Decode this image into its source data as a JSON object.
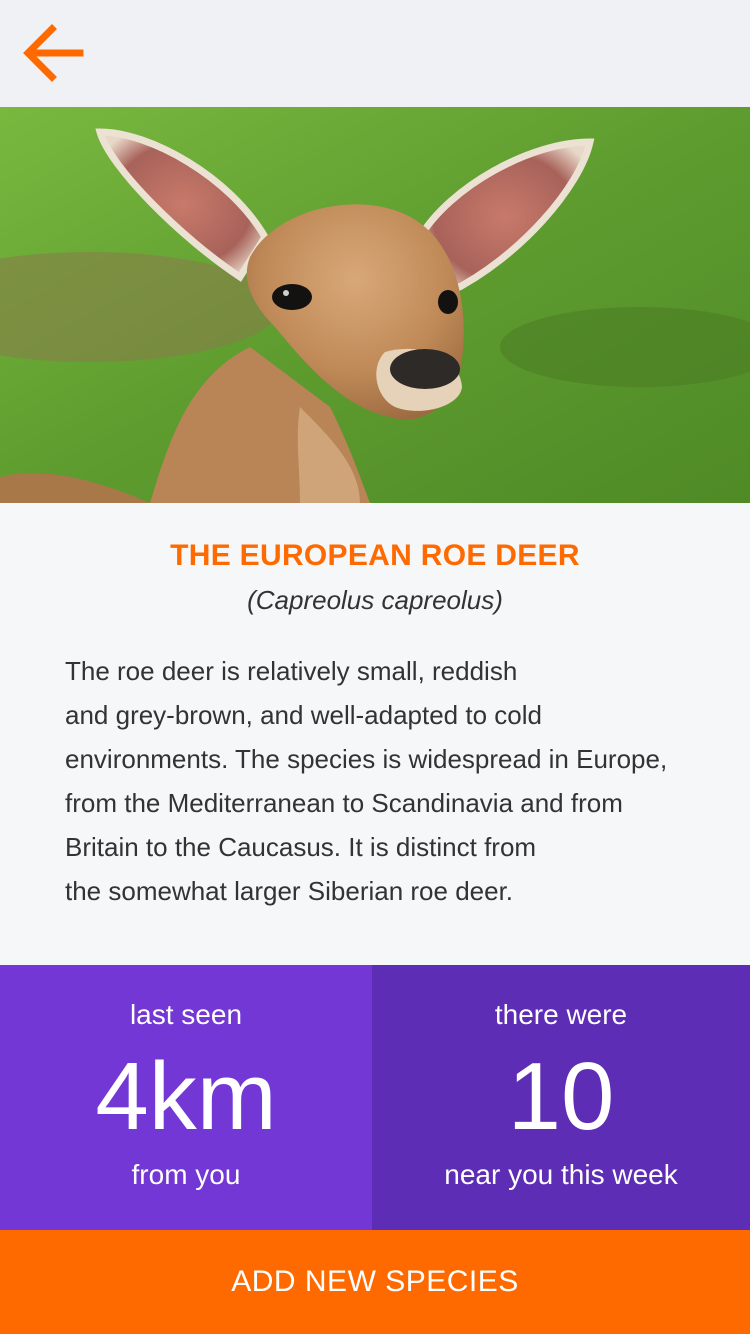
{
  "header": {
    "back_icon": "arrow-left-icon",
    "accent_color": "#ff6a00"
  },
  "hero": {
    "image": "roe-deer-photo"
  },
  "species": {
    "title": "THE EUROPEAN ROE DEER",
    "latin_name": "(Capreolus capreolus)",
    "description_lines": [
      "The roe deer is relatively small, reddish",
      "and grey-brown, and well-adapted to cold",
      "environments. The species is widespread in Europe,",
      "from the Mediterranean to Scandinavia and from",
      "Britain to the Caucasus. It is distinct from",
      "the somewhat larger Siberian roe deer."
    ]
  },
  "stats": {
    "last_seen": {
      "label_top": "last seen",
      "value": "4km",
      "label_bottom": "from you",
      "color": "#7337d6"
    },
    "count": {
      "label_top": "there were",
      "value": "10",
      "label_bottom": "near you this week",
      "color": "#5e2db5"
    }
  },
  "cta": {
    "label": "ADD NEW SPECIES",
    "color": "#ff6a00"
  }
}
